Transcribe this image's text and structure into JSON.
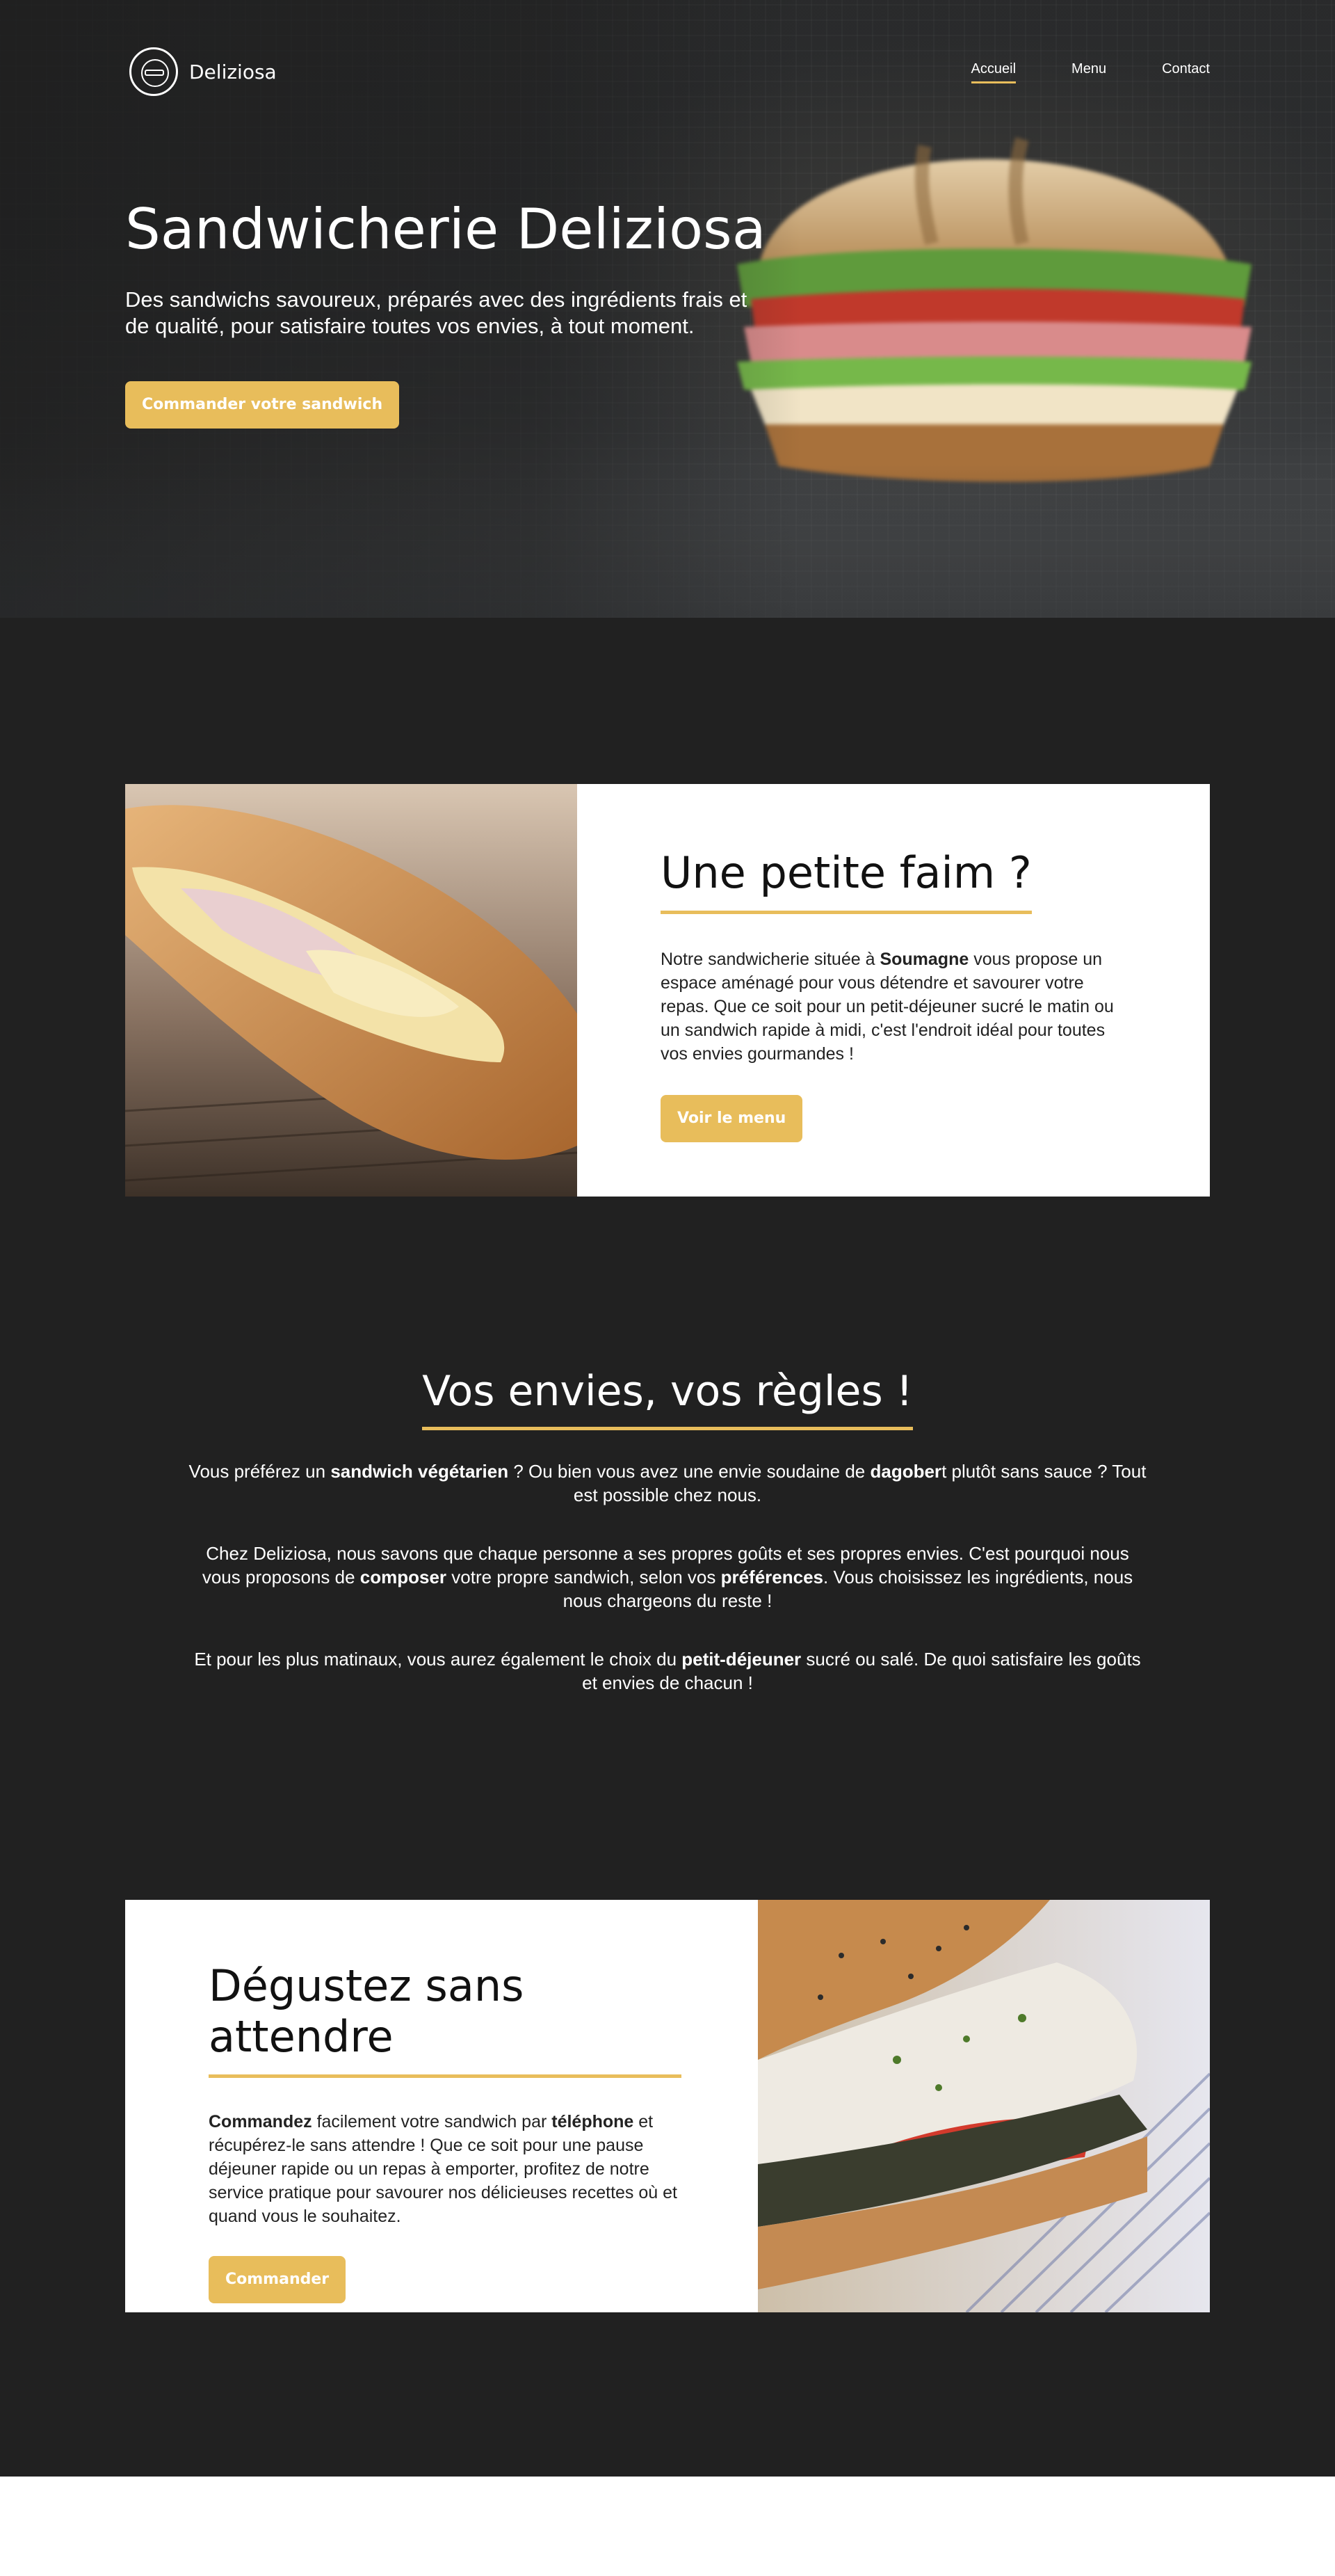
{
  "brand": {
    "name": "Deliziosa"
  },
  "nav": {
    "items": [
      "Accueil",
      "Menu",
      "Contact"
    ],
    "active": "Accueil"
  },
  "hero": {
    "title": "Sandwicherie Deliziosa",
    "subtitle": "Des sandwichs savoureux, préparés avec des ingrédients frais et de qualité, pour satisfaire toutes vos envies, à tout moment.",
    "cta": "Commander votre sandwich"
  },
  "section1": {
    "title": "Une petite faim ?",
    "text_before": "Notre sandwicherie située à ",
    "text_bold": "Soumagne",
    "text_after": " vous propose un espace aménagé pour vous détendre et savourer votre repas. Que ce soit pour un petit-déjeuner sucré le matin ou un sandwich rapide à midi, c'est l'endroit idéal pour toutes vos envies gourmandes !",
    "cta": "Voir le menu"
  },
  "section2": {
    "title": "Vos envies, vos règles !",
    "p1": {
      "a": "Vous préférez un ",
      "b": "sandwich végétarien",
      "c": " ? Ou bien vous avez une envie soudaine de ",
      "d": "dagober",
      "e": "t plutôt sans sauce ? Tout est possible chez nous."
    },
    "p2": {
      "a": "Chez Deliziosa, nous savons que chaque personne a ses propres goûts et ses propres envies. C'est pourquoi nous vous proposons de ",
      "b": "composer",
      "c": " votre propre sandwich, selon vos ",
      "d": "préférences",
      "e": ". Vous choisissez les ingrédients, nous nous chargeons du reste !"
    },
    "p3": {
      "a": "Et pour les plus matinaux, vous aurez également le choix du ",
      "b": "petit-déjeuner",
      "c": " sucré ou salé. De quoi satisfaire les goûts et envies de chacun !"
    }
  },
  "section3": {
    "title": "Dégustez sans attendre",
    "b1": "Commandez",
    "t1": " facilement votre sandwich par ",
    "b2": "téléphone",
    "t2": " et récupérez-le sans attendre ! Que ce soit pour une pause déjeuner rapide ou un repas à emporter, profitez de notre service pratique pour savourer nos délicieuses recettes où et quand vous le souhaitez.",
    "cta": "Commander"
  },
  "colors": {
    "accent": "#e8bd5b",
    "background": "#212121",
    "card": "#ffffff"
  }
}
